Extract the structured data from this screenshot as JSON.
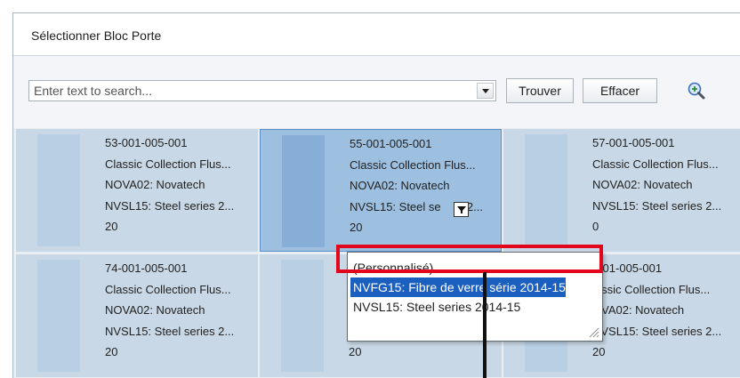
{
  "window": {
    "title": "Sélectionner Bloc Porte"
  },
  "toolbar": {
    "search_placeholder": "Enter text to search...",
    "find_label": "Trouver",
    "clear_label": "Effacer",
    "zoom_icon": "zoom-in-icon"
  },
  "tiles": [
    {
      "lines": [
        "53-001-005-001",
        "Classic Collection Flus...",
        "NOVA02: Novatech",
        "NVSL15: Steel series 2...",
        "20"
      ]
    },
    {
      "lines": [
        "55-001-005-001",
        "Classic Collection Flus...",
        "NOVA02: Novatech",
        "NVSL15: Steel se",
        "2...",
        "20"
      ],
      "selected": true
    },
    {
      "lines": [
        "57-001-005-001",
        "Classic Collection Flus...",
        "NOVA02: Novatech",
        "NVSL15: Steel series 2...",
        "0"
      ]
    },
    {
      "lines": [
        "74-001-005-001",
        "Classic Collection Flus...",
        "NOVA02: Novatech",
        "NVSL15: Steel series 2...",
        "20"
      ]
    },
    {
      "lines": [
        "",
        "",
        "",
        "NVSL15: Steel series 2...",
        "20"
      ]
    },
    {
      "lines": [
        "-001-005-001",
        "lassic Collection Flus...",
        "OVA02: Novatech",
        "NVSL15: Steel series 2...",
        "20"
      ]
    }
  ],
  "popup": {
    "items": [
      "(Personnalisé)",
      "NVFG15: Fibre de verre série 2014-15",
      "NVSL15: Steel series 2014-15"
    ]
  },
  "colors": {
    "selection_blue": "#1b5fbf",
    "annotation_red": "#e3051c",
    "tile_bg": "#c9d8e6",
    "tile_selected_bg": "#9dbfe0"
  }
}
